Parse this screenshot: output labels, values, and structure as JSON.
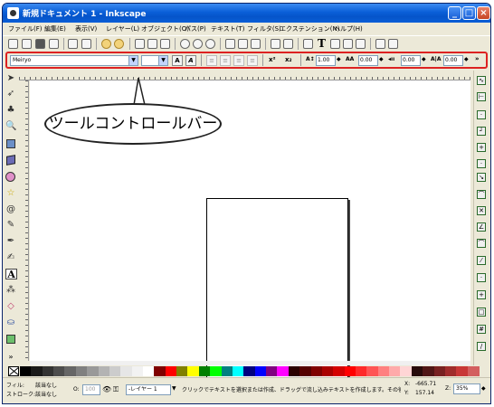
{
  "window": {
    "title": "新規ドキュメント 1 - Inkscape",
    "controls": {
      "minimize": "_",
      "maximize": "□",
      "close": "×"
    }
  },
  "menubar": {
    "items": [
      "ファイル(F)",
      "編集(E)",
      "表示(V)",
      "レイヤー(L)",
      "オブジェクト(O)",
      "パス(P)",
      "テキスト(T)",
      "フィルタ(S)",
      "エクステンション(N)",
      "ヘルプ(H)"
    ]
  },
  "commandbar": {
    "text_tool_glyph": "T"
  },
  "tool_controls": {
    "font_family": "Meiryo",
    "font_size": "",
    "bold_label": "A",
    "italic_label": "A",
    "superscript_label": "x²",
    "subscript_label": "x₂",
    "line_spacing": "1.00",
    "letter_spacing": "0.00",
    "word_spacing": "0.00",
    "rotation": "0.00",
    "more": "»"
  },
  "callout": {
    "text": "ツールコントロールバー"
  },
  "toolbox": {
    "text_tool_glyph": "A",
    "more": "»"
  },
  "palette": {
    "colors": [
      "#000000",
      "#1a1a1a",
      "#333333",
      "#4d4d4d",
      "#666666",
      "#808080",
      "#999999",
      "#b3b3b3",
      "#cccccc",
      "#e6e6e6",
      "#f2f2f2",
      "#ffffff",
      "#800000",
      "#ff0000",
      "#808000",
      "#ffff00",
      "#008000",
      "#00ff00",
      "#008080",
      "#00ffff",
      "#000080",
      "#0000ff",
      "#800080",
      "#ff00ff",
      "#2b0000",
      "#550000",
      "#800000",
      "#aa0000",
      "#d40000",
      "#ff0000",
      "#ff2a2a",
      "#ff5555",
      "#ff8080",
      "#ffaaaa",
      "#ffd5d5",
      "#280b0b",
      "#501616",
      "#782121",
      "#a02c2c",
      "#c83737",
      "#d35f5f"
    ]
  },
  "statusbar": {
    "fill_label": "フィル:",
    "fill_value": "該当なし",
    "stroke_label": "ストローク:",
    "stroke_value": "該当なし",
    "opacity_label": "O:",
    "opacity_value": "100",
    "layer_name": "-レイヤー 1",
    "message": "クリックでテキストを選択または作成、ドラッグで流し込みテキストを作成します。その後入",
    "x_label": "X:",
    "x_value": "-665.71",
    "y_label": "Y:",
    "y_value": "157.14",
    "zoom_label": "Z:",
    "zoom_value": "35%"
  },
  "colors": {
    "title_bar": "#0a5fd8",
    "highlight_border": "#dd2222",
    "chrome": "#ece9d8"
  }
}
